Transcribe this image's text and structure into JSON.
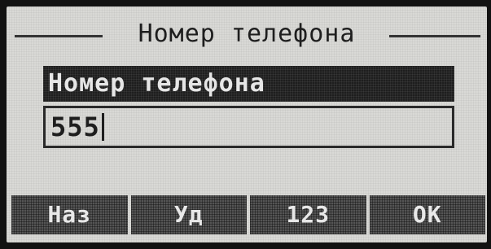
{
  "screen": {
    "title": "Номер телефона"
  },
  "field": {
    "label": "Номер телефона",
    "value": "555"
  },
  "softkeys": [
    {
      "label": "Наз"
    },
    {
      "label": "Уд"
    },
    {
      "label": "123"
    },
    {
      "label": "OK"
    }
  ],
  "colors": {
    "lcd_background": "#d9d9d6",
    "pixel_dark": "#1e1e1e",
    "softkey_background": "#555555",
    "softkey_text": "#e8e8e8"
  }
}
